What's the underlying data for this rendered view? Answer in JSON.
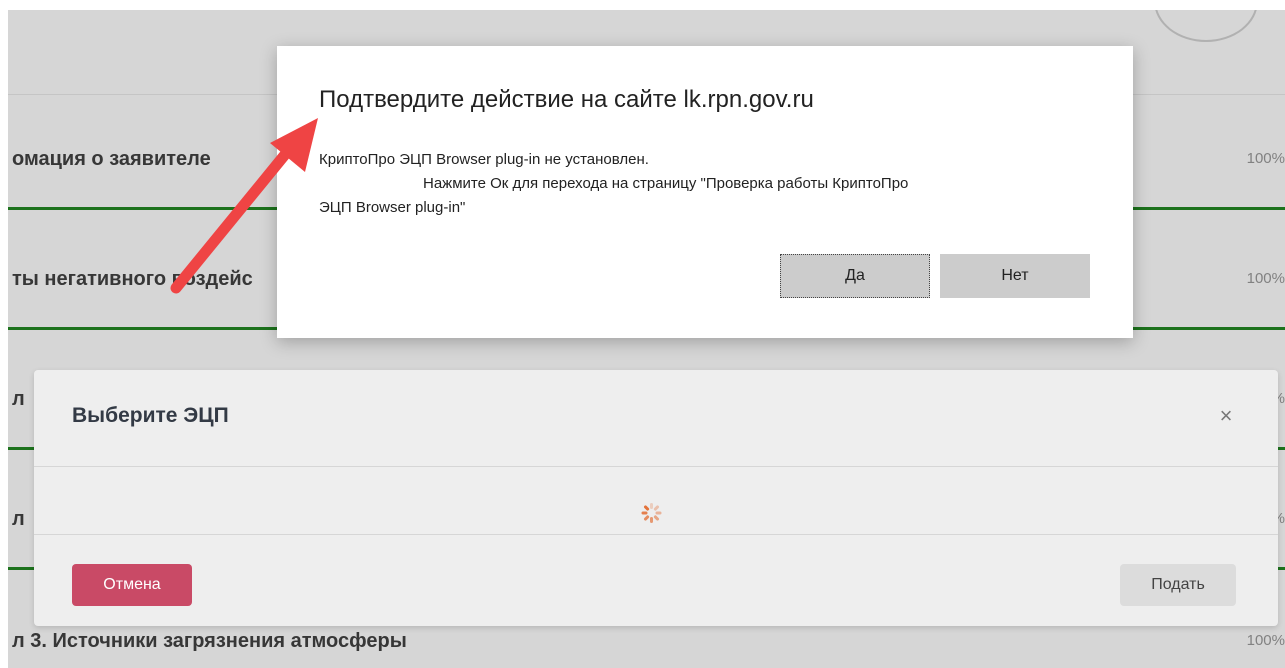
{
  "page": {
    "rows": [
      {
        "title": "омация о заявителе",
        "percent": "100%"
      },
      {
        "title": "ты негативного воздейс",
        "percent": "100%"
      },
      {
        "title": "л",
        "percent": "%"
      },
      {
        "title": "л",
        "percent": "%"
      },
      {
        "title": "л 3. Источники загрязнения атмосферы",
        "percent": "100%"
      }
    ]
  },
  "confirm_dialog": {
    "title": "Подтвердите действие на сайте lk.rpn.gov.ru",
    "message_line1": "КриптоПро ЭЦП Browser plug-in не установлен.",
    "message_line2": "Нажмите Ок для перехода на страницу \"Проверка работы КриптоПро",
    "message_line3": "ЭЦП Browser plug-in\"",
    "yes_label": "Да",
    "no_label": "Нет"
  },
  "sign_modal": {
    "title": "Выберите ЭЦП",
    "close_glyph": "×",
    "cancel_label": "Отмена",
    "submit_label": "Подать",
    "loading": true
  },
  "colors": {
    "arrow": "#ef4444",
    "progress_bar": "#1f7a1f",
    "cancel_button": "#c94a66",
    "spinner": "#e26b30"
  }
}
